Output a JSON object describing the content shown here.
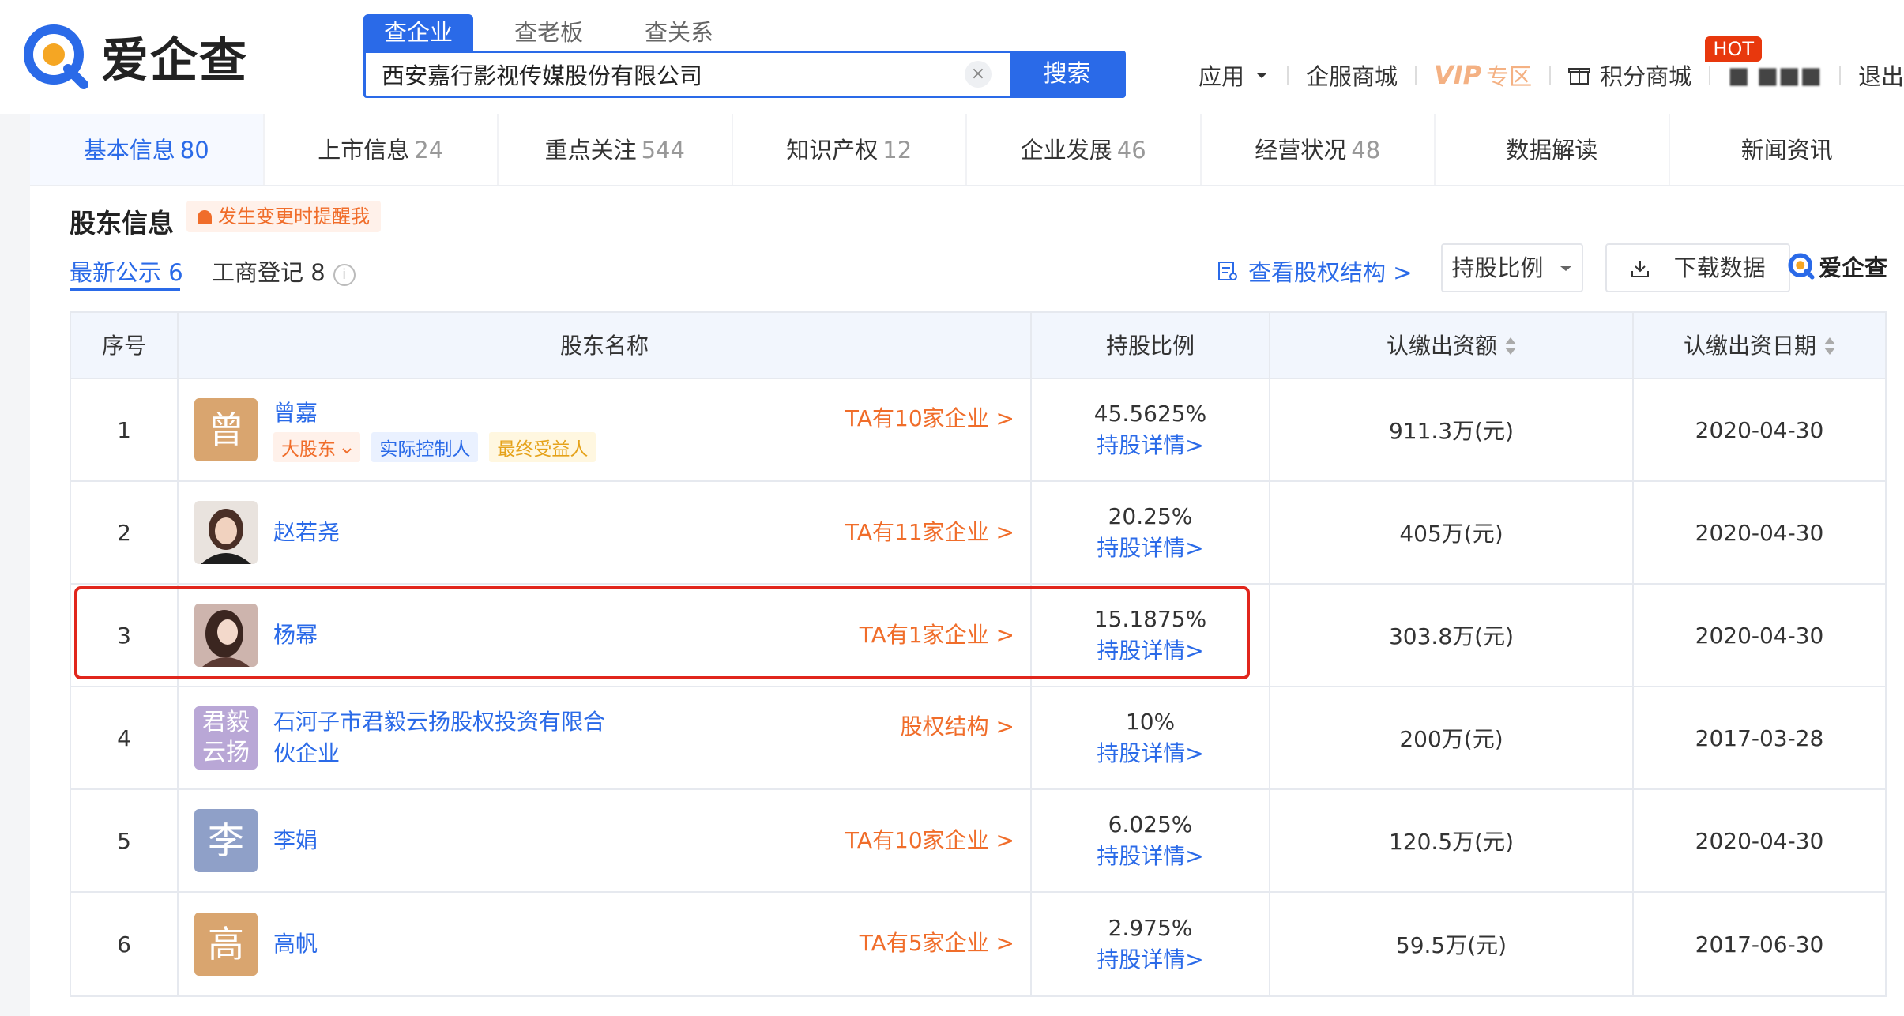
{
  "brand": {
    "name": "爱企查"
  },
  "search": {
    "tabs": [
      "查企业",
      "查老板",
      "查关系"
    ],
    "value": "西安嘉行影视传媒股份有限公司",
    "clear_label": "×",
    "button_label": "搜索"
  },
  "topnav": {
    "apps_label": "应用",
    "mall_label": "企服商城",
    "vip_label": "VIP",
    "vip_zone_label": "专区",
    "points_label": "积分商城",
    "hot_label": "HOT",
    "user_label": "■ ■■■",
    "logout_label": "退出"
  },
  "tabs": [
    {
      "label": "基本信息",
      "count": "80"
    },
    {
      "label": "上市信息",
      "count": "24"
    },
    {
      "label": "重点关注",
      "count": "544"
    },
    {
      "label": "知识产权",
      "count": "12"
    },
    {
      "label": "企业发展",
      "count": "46"
    },
    {
      "label": "经营状况",
      "count": "48"
    },
    {
      "label": "数据解读",
      "count": ""
    },
    {
      "label": "新闻资讯",
      "count": ""
    }
  ],
  "section": {
    "title": "股东信息",
    "remind_label": "发生变更时提醒我",
    "subtab_latest": "最新公示 6",
    "subtab_registry": "工商登记 8",
    "info_icon": "i",
    "equity_link": "查看股权结构 >",
    "ratio_dropdown": "持股比例",
    "download_label": "下载数据",
    "mini_brand": "爱企查"
  },
  "table": {
    "headers": [
      "序号",
      "股东名称",
      "持股比例",
      "认缴出资额",
      "认缴出资日期"
    ],
    "rows": [
      {
        "index": "1",
        "avatar": "曾",
        "name": "曾嘉",
        "link": "TA有10家企业 >",
        "percent": "45.5625%",
        "detail": "持股详情>",
        "amount": "911.3万(元)",
        "date": "2020-04-30",
        "tags": [
          "大股东",
          "实际控制人",
          "最终受益人"
        ]
      },
      {
        "index": "2",
        "avatar": "",
        "name": "赵若尧",
        "link": "TA有11家企业 >",
        "percent": "20.25%",
        "detail": "持股详情>",
        "amount": "405万(元)",
        "date": "2020-04-30"
      },
      {
        "index": "3",
        "avatar": "",
        "name": "杨幂",
        "link": "TA有1家企业 >",
        "percent": "15.1875%",
        "detail": "持股详情>",
        "amount": "303.8万(元)",
        "date": "2020-04-30"
      },
      {
        "index": "4",
        "avatar": "君毅云扬",
        "avatar_line1": "君毅",
        "avatar_line2": "云扬",
        "name_line1": "石河子市君毅云扬股权投资有限合",
        "name_line2": "伙企业",
        "link": "股权结构 >",
        "percent": "10%",
        "detail": "持股详情>",
        "amount": "200万(元)",
        "date": "2017-03-28"
      },
      {
        "index": "5",
        "avatar": "李",
        "name": "李娟",
        "link": "TA有10家企业 >",
        "percent": "6.025%",
        "detail": "持股详情>",
        "amount": "120.5万(元)",
        "date": "2020-04-30"
      },
      {
        "index": "6",
        "avatar": "高",
        "name": "高帆",
        "link": "TA有5家企业 >",
        "percent": "2.975%",
        "detail": "持股详情>",
        "amount": "59.5万(元)",
        "date": "2017-06-30"
      }
    ]
  },
  "colors": {
    "accent": "#2a6ae8",
    "orange": "#f06d2a",
    "highlight": "#e1261c"
  }
}
